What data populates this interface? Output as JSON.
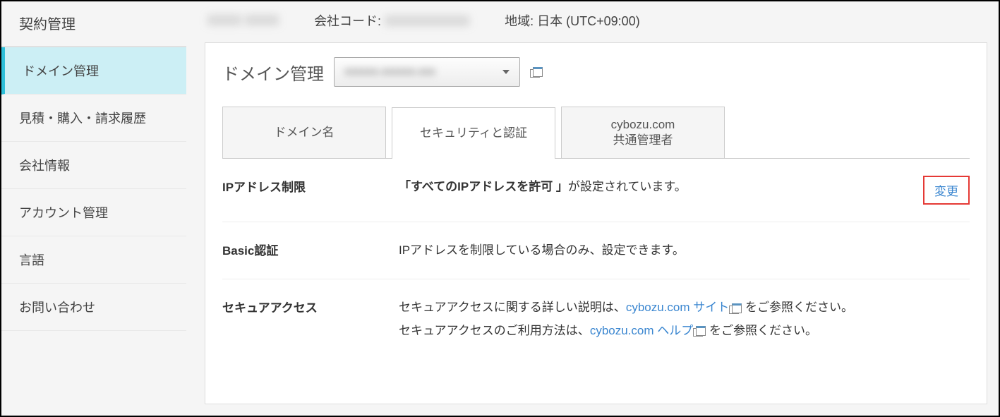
{
  "sidebar": {
    "items": [
      {
        "label": "契約管理"
      },
      {
        "label": "ドメイン管理"
      },
      {
        "label": "見積・購入・請求履歴"
      },
      {
        "label": "会社情報"
      },
      {
        "label": "アカウント管理"
      },
      {
        "label": "言語"
      },
      {
        "label": "お問い合わせ"
      }
    ]
  },
  "header": {
    "blurred_owner": "XXXX XXXX",
    "company_code_label": "会社コード:",
    "blurred_code": "XXXXXXXXXX",
    "region_label": "地域: 日本 (UTC+09:00)"
  },
  "panel": {
    "title": "ドメイン管理",
    "domain_blur": "xxxxxx.xxxxxx.xxx"
  },
  "tabs": [
    {
      "label": "ドメイン名"
    },
    {
      "label": "セキュリティと認証"
    },
    {
      "label": "cybozu.com\n共通管理者"
    }
  ],
  "rows": {
    "ip": {
      "label": "IPアドレス制限",
      "bold": "「すべてのIPアドレスを許可 」",
      "suffix": "が設定されています。",
      "change": "変更"
    },
    "basic": {
      "label": "Basic認証",
      "text": "IPアドレスを制限している場合のみ、設定できます。"
    },
    "secure": {
      "label": "セキュアアクセス",
      "pre1": "セキュアアクセスに関する詳しい説明は、",
      "link1": "cybozu.com サイト",
      "suf1": " をご参照ください。",
      "pre2": "セキュアアクセスのご利用方法は、",
      "link2": "cybozu.com ヘルプ",
      "suf2": " をご参照ください。"
    }
  }
}
